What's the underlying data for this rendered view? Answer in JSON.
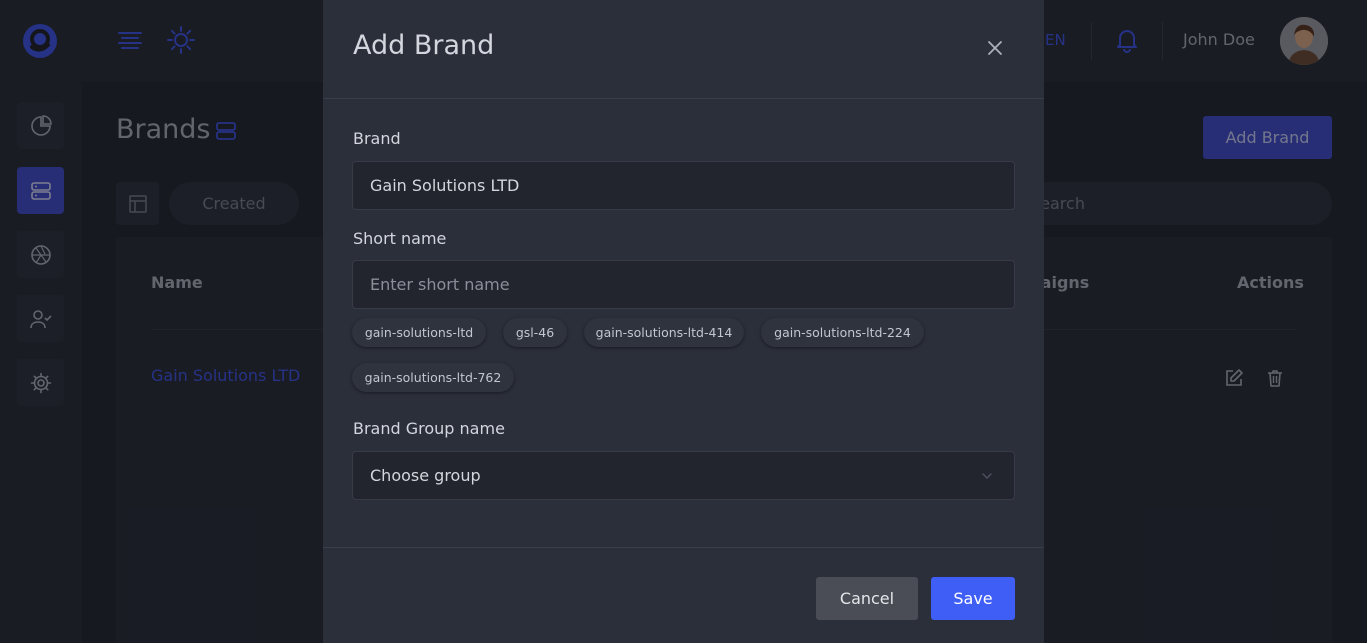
{
  "header": {
    "language": "EN",
    "user_name": "John Doe"
  },
  "page": {
    "title": "Brands",
    "add_button": "Add Brand",
    "filter_created": "Created",
    "search_placeholder": "Search"
  },
  "table": {
    "columns": [
      "Name",
      "Campaigns",
      "Actions"
    ],
    "rows": [
      {
        "name": "Gain Solutions LTD"
      }
    ]
  },
  "modal": {
    "title": "Add Brand",
    "brand_label": "Brand",
    "brand_value": "Gain Solutions LTD",
    "short_name_label": "Short name",
    "short_name_placeholder": "Enter short name",
    "suggestions": [
      "gain-solutions-ltd",
      "gsl-46",
      "gain-solutions-ltd-414",
      "gain-solutions-ltd-224",
      "gain-solutions-ltd-762"
    ],
    "group_label": "Brand Group name",
    "group_value": "Choose group",
    "cancel_label": "Cancel",
    "save_label": "Save"
  },
  "colors": {
    "accent": "#3f5ef5",
    "accent_dim": "#3e4cc9",
    "modal_bg": "#2b2f3a",
    "input_bg": "#22252e"
  },
  "icons": {
    "logo": "g-logo-icon",
    "menu": "menu-lines-icon",
    "theme": "sun-icon",
    "notifications": "bell-icon",
    "close": "close-icon",
    "dropdown": "chevron-down-icon"
  }
}
